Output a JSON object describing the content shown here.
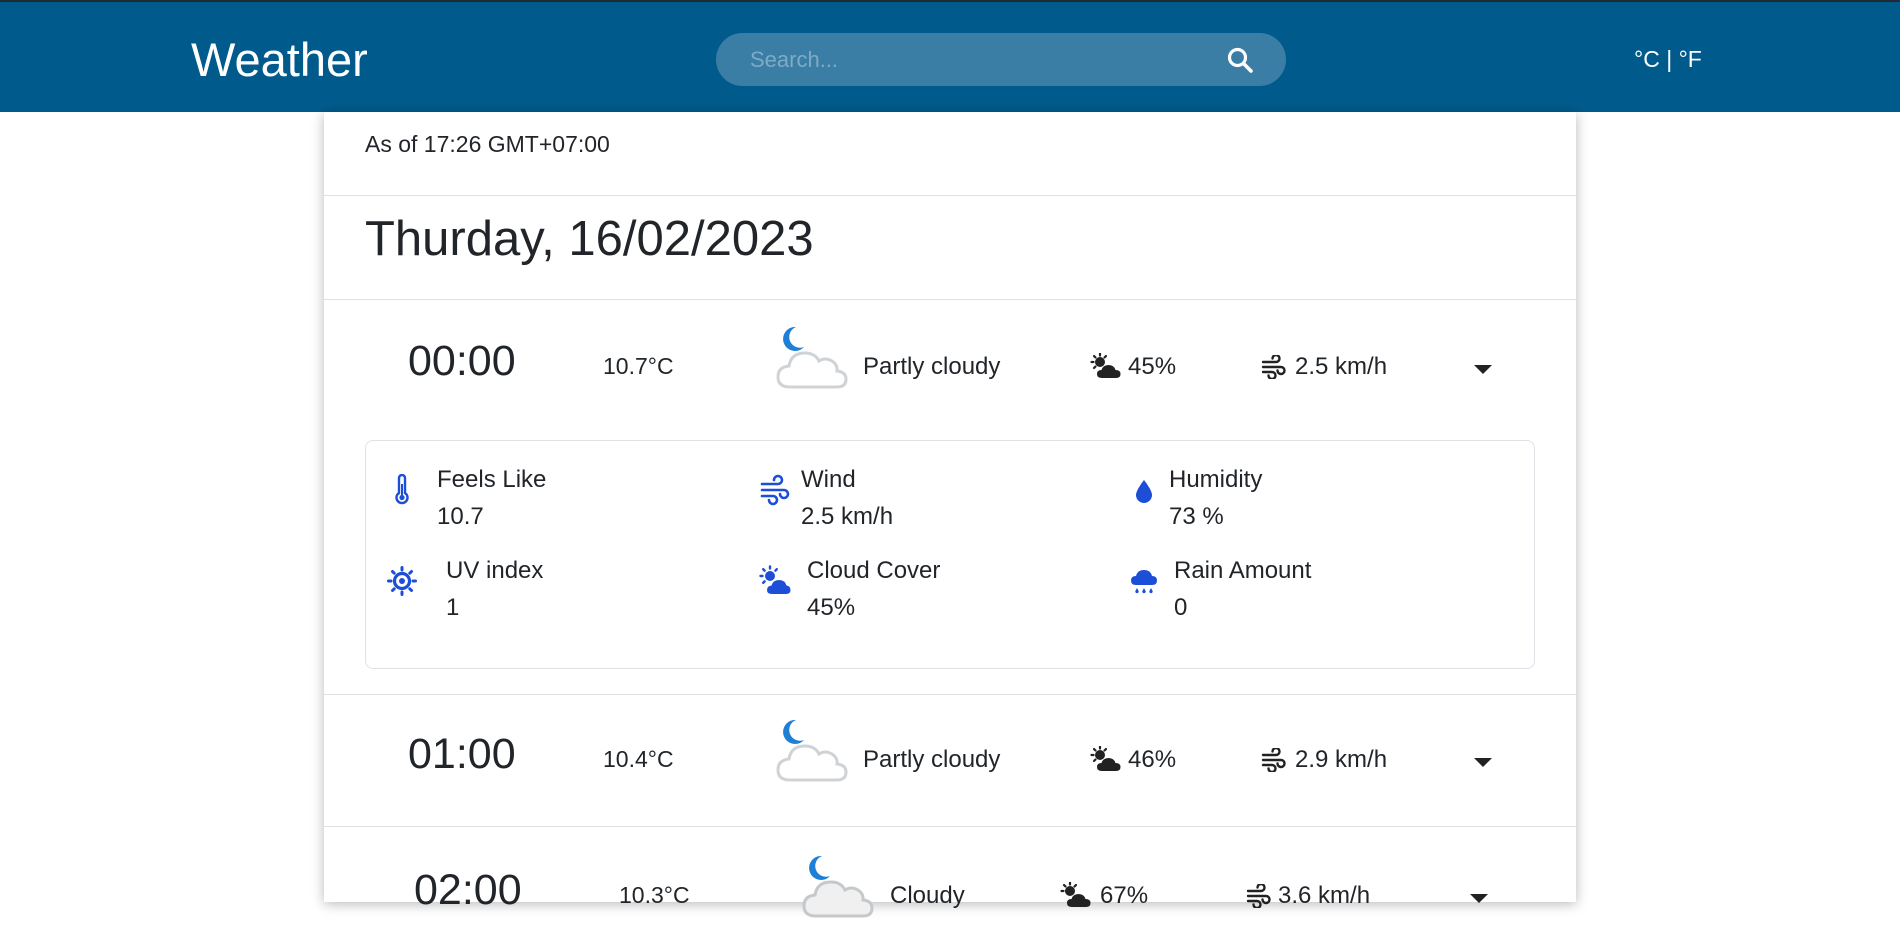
{
  "header": {
    "brand": "Weather",
    "search_placeholder": "Search...",
    "units_toggle": "°C | °F"
  },
  "as_of": "As of 17:26 GMT+07:00",
  "date_title": "Thurday, 16/02/2023",
  "hours": [
    {
      "time": "00:00",
      "temp": "10.7°C",
      "condition": "Partly cloudy",
      "cloud": "45%",
      "wind": "2.5 km/h",
      "icon": "moon-cloud-icon",
      "expanded": true
    },
    {
      "time": "01:00",
      "temp": "10.4°C",
      "condition": "Partly cloudy",
      "cloud": "46%",
      "wind": "2.9 km/h",
      "icon": "moon-cloud-icon",
      "expanded": false
    },
    {
      "time": "02:00",
      "temp": "10.3°C",
      "condition": "Cloudy",
      "cloud": "67%",
      "wind": "3.6 km/h",
      "icon": "moon-cloud-icon",
      "expanded": false
    }
  ],
  "details": {
    "feels_like": {
      "label": "Feels Like",
      "value": "10.7",
      "icon": "thermometer-icon"
    },
    "wind": {
      "label": "Wind",
      "value": "2.5 km/h",
      "icon": "wind-icon"
    },
    "humidity": {
      "label": "Humidity",
      "value": "73 %",
      "icon": "droplet-icon"
    },
    "uv_index": {
      "label": "UV index",
      "value": "1",
      "icon": "sun-icon"
    },
    "cloud_cover": {
      "label": "Cloud Cover",
      "value": "45%",
      "icon": "sun-cloud-icon"
    },
    "rain_amount": {
      "label": "Rain Amount",
      "value": "0",
      "icon": "rain-cloud-icon"
    }
  },
  "colors": {
    "header_bg": "#005b8c",
    "search_bg": "#3a7ea6",
    "detail_icon": "#1d4ed8",
    "moon": "#1e7fd6"
  }
}
